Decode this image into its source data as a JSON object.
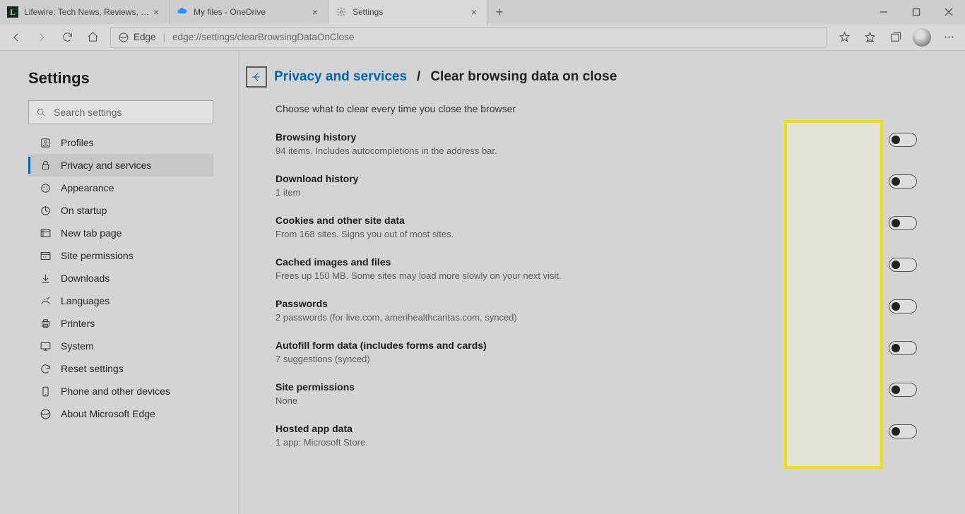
{
  "window": {
    "tabs": [
      {
        "title": "Lifewire: Tech News, Reviews, He",
        "favicon": "L"
      },
      {
        "title": "My files - OneDrive",
        "favicon": "cloud"
      },
      {
        "title": "Settings",
        "favicon": "gear",
        "active": true
      }
    ]
  },
  "addressbar": {
    "scheme_label": "Edge",
    "url": "edge://settings/clearBrowsingDataOnClose"
  },
  "sidebar": {
    "title": "Settings",
    "search_placeholder": "Search settings",
    "items": [
      {
        "label": "Profiles"
      },
      {
        "label": "Privacy and services"
      },
      {
        "label": "Appearance"
      },
      {
        "label": "On startup"
      },
      {
        "label": "New tab page"
      },
      {
        "label": "Site permissions"
      },
      {
        "label": "Downloads"
      },
      {
        "label": "Languages"
      },
      {
        "label": "Printers"
      },
      {
        "label": "System"
      },
      {
        "label": "Reset settings"
      },
      {
        "label": "Phone and other devices"
      },
      {
        "label": "About Microsoft Edge"
      }
    ],
    "active_index": 1
  },
  "page": {
    "breadcrumb_link": "Privacy and services",
    "breadcrumb_sep": "/",
    "breadcrumb_current": "Clear browsing data on close",
    "description": "Choose what to clear every time you close the browser",
    "options": [
      {
        "title": "Browsing history",
        "desc": "94 items. Includes autocompletions in the address bar."
      },
      {
        "title": "Download history",
        "desc": "1 item"
      },
      {
        "title": "Cookies and other site data",
        "desc": "From 168 sites. Signs you out of most sites."
      },
      {
        "title": "Cached images and files",
        "desc": "Frees up 150 MB. Some sites may load more slowly on your next visit."
      },
      {
        "title": "Passwords",
        "desc": "2 passwords (for live.com, amerihealthcaritas.com, synced)"
      },
      {
        "title": "Autofill form data (includes forms and cards)",
        "desc": "7 suggestions (synced)"
      },
      {
        "title": "Site permissions",
        "desc": "None"
      },
      {
        "title": "Hosted app data",
        "desc": "1 app: Microsoft Store."
      }
    ]
  }
}
